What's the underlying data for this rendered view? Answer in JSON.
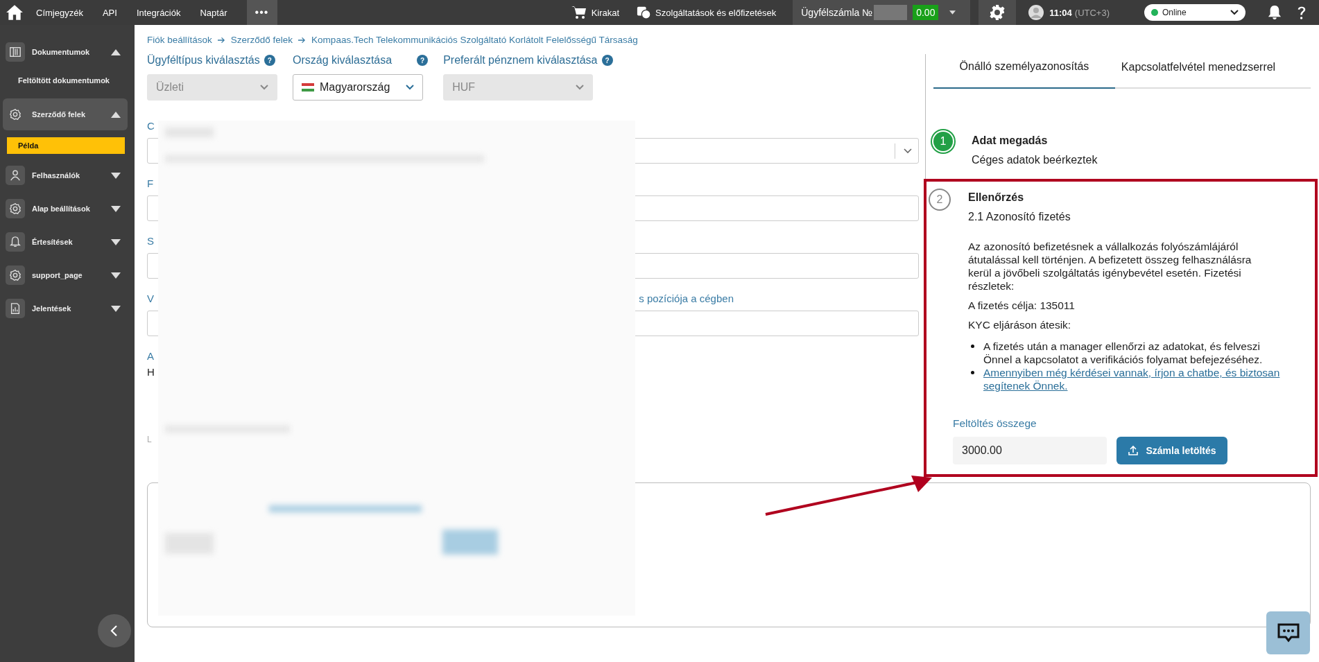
{
  "topbar": {
    "nav": [
      {
        "label": "Címjegyzék"
      },
      {
        "label": "API"
      },
      {
        "label": "Integrációk"
      },
      {
        "label": "Naptár"
      }
    ],
    "more": "•••",
    "shop": "Kirakat",
    "services": "Szolgáltatások és előfizetések",
    "account": {
      "label": "Ügyfélszámla №",
      "balance": "0.00"
    },
    "time": "11:04",
    "timezone": "(UTC+3)",
    "status": "Online"
  },
  "sidebar": {
    "items": [
      {
        "label": "Dokumentumok",
        "expanded": true,
        "selected": false,
        "children": [
          {
            "label": "Feltöltött dokumentumok",
            "selected": false
          }
        ]
      },
      {
        "label": "Szerződő felek",
        "expanded": true,
        "selected": true,
        "children": [
          {
            "label": "Példa",
            "selected": true
          }
        ]
      },
      {
        "label": "Felhasználók",
        "expanded": false,
        "selected": false
      },
      {
        "label": "Alap beállítások",
        "expanded": false,
        "selected": false
      },
      {
        "label": "Értesítések",
        "expanded": false,
        "selected": false
      },
      {
        "label": "support_page",
        "expanded": false,
        "selected": false
      },
      {
        "label": "Jelentések",
        "expanded": false,
        "selected": false
      }
    ]
  },
  "breadcrumb": [
    "Fiók beállítások",
    "Szerződő felek",
    "Kompaas.Tech Telekommunikációs Szolgáltató Korlátolt Felelősségű Társaság"
  ],
  "selectors": [
    {
      "label": "Ügyféltípus kiválasztás",
      "help": "?",
      "value": "Üzleti",
      "disabled": true,
      "flag": false
    },
    {
      "label": "Ország kiválasztása",
      "help": "?",
      "value": "Magyarország",
      "disabled": false,
      "flag": true
    },
    {
      "label": "Preferált pénznem kiválasztása",
      "help": "?",
      "value": "HUF",
      "disabled": true,
      "flag": false
    }
  ],
  "form_fields": [
    {
      "kind": "select",
      "label": "C"
    },
    {
      "kind": "input",
      "label": "F"
    },
    {
      "kind": "input",
      "label": "S"
    },
    {
      "kind": "pair",
      "label": "V",
      "label_2": "s pozíciója a cégben"
    }
  ],
  "form_lines": [
    {
      "kind": "label",
      "text": "A"
    },
    {
      "kind": "value",
      "text": "H"
    },
    {
      "kind": "note",
      "text": "L"
    }
  ],
  "tabs": [
    {
      "label": "Önálló személyazonosítás",
      "selected": true
    },
    {
      "label": "Kapcsolatfelvétel menedzserrel",
      "selected": false
    }
  ],
  "steps": [
    {
      "number": "1",
      "title": "Adat megadás",
      "subtitle": "Céges adatok beérkeztek",
      "done": true
    },
    {
      "number": "2",
      "title": "Ellenőrzés",
      "subtitle": "2.1 Azonosító fizetés",
      "done": false
    }
  ],
  "payment": {
    "description": "Az azonosító befizetésnek a vállalkozás folyószámlájáról átutalással kell történjen. A befizetett összeg felhasználásra kerül a jövőbeli szolgáltatás igénybevétel esetén. Fizetési részletek:",
    "purpose": "A fizetés célja: 135011",
    "kyc": "KYC eljáráson átesik:",
    "bullets": [
      {
        "kind": "text",
        "text": "A fizetés után a manager ellenőrzi az adatokat, és felveszi Önnel a kapcsolatot a verifikációs folyamat befejezéséhez."
      },
      {
        "kind": "link",
        "text": "Amennyiben még kérdései vannak, írjon a chatbe, és biztosan segítenek Önnek."
      }
    ],
    "amount_label": "Feltöltés összege",
    "amount": "3000.00",
    "button": "Számla letöltés"
  }
}
